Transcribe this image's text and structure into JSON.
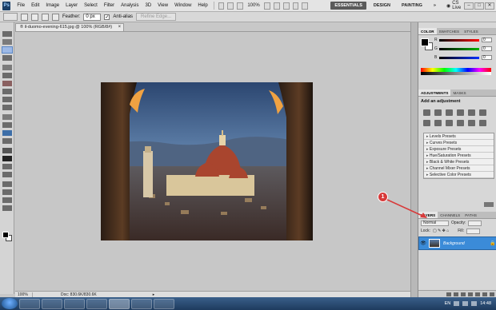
{
  "menubar": {
    "app_logo": "Ps",
    "menus": [
      "File",
      "Edit",
      "Image",
      "Layer",
      "Select",
      "Filter",
      "Analysis",
      "3D",
      "View",
      "Window",
      "Help"
    ],
    "zoom": "100%",
    "workspaces": [
      "ESSENTIALS",
      "DESIGN",
      "PAINTING"
    ],
    "workspace_more": "»",
    "cs_live": "CS Live",
    "window_controls": [
      "–",
      "□",
      "✕"
    ]
  },
  "options": {
    "feather_label": "Feather:",
    "feather_value": "0 px",
    "antialias_label": "Anti-alias",
    "refine_edge": "Refine Edge..."
  },
  "document": {
    "tab_title": "® il-duomo-evening-615.jpg @ 100% (RGB/8#)",
    "tab_close": "×"
  },
  "status": {
    "zoom": "100%",
    "doc_info": "Doc: 830.6K/830.6K",
    "arrow": "▸"
  },
  "color_panel": {
    "tabs": [
      "COLOR",
      "SWATCHES",
      "STYLES"
    ],
    "rows": [
      {
        "label": "R",
        "value": "0",
        "gradient": "linear-gradient(to right,#000,#ff0000)"
      },
      {
        "label": "G",
        "value": "0",
        "gradient": "linear-gradient(to right,#000,#00b400)"
      },
      {
        "label": "B",
        "value": "0",
        "gradient": "linear-gradient(to right,#000,#0030ff)"
      }
    ]
  },
  "adjustments_panel": {
    "tabs": [
      "ADJUSTMENTS",
      "MASKS"
    ],
    "title": "Add an adjustment",
    "presets": [
      "Levels Presets",
      "Curves Presets",
      "Exposure Presets",
      "Hue/Saturation Presets",
      "Black & White Presets",
      "Channel Mixer Presets",
      "Selective Color Presets"
    ]
  },
  "layers_panel": {
    "tabs": [
      "LAYERS",
      "CHANNELS",
      "PATHS"
    ],
    "blend_mode": "Normal",
    "opacity_label": "Opacity:",
    "lock_label": "Lock:",
    "fill_label": "Fill:",
    "layers": [
      {
        "name": "Background",
        "visible_icon": "👁",
        "lock_icon": "🔒"
      }
    ]
  },
  "callout": {
    "number": "1",
    "color": "#d83a3a"
  },
  "taskbar": {
    "language": "EN",
    "clock": "14:48"
  },
  "toolbox": {
    "tools": [
      "move-tool",
      "marquee-tool",
      "lasso-tool",
      "quick-select-tool",
      "crop-tool",
      "eyedropper-tool",
      "healing-tool",
      "brush-tool",
      "clone-stamp-tool",
      "history-brush-tool",
      "eraser-tool",
      "gradient-tool",
      "blur-tool",
      "dodge-tool",
      "pen-tool",
      "type-tool",
      "path-select-tool",
      "shape-tool",
      "3d-rotate-tool",
      "3d-orbit-tool",
      "hand-tool",
      "zoom-tool"
    ]
  }
}
